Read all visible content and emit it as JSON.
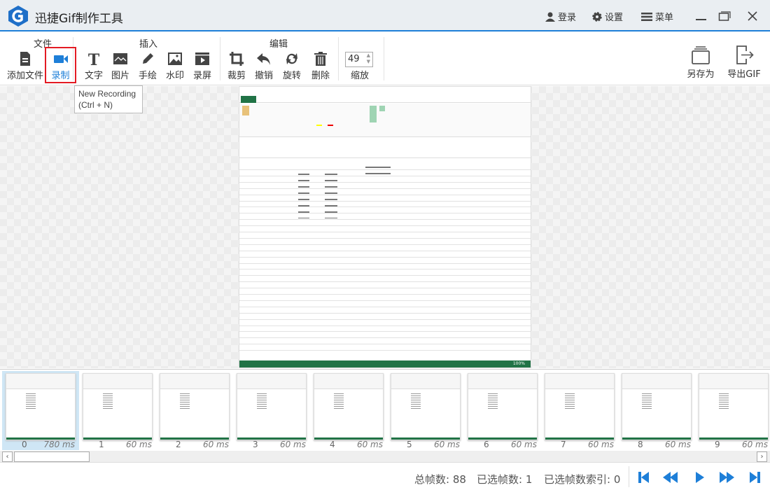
{
  "app": {
    "title": "迅捷Gif制作工具"
  },
  "titlebar": {
    "login": "登录",
    "settings": "设置",
    "menu": "菜单"
  },
  "toolbar": {
    "groups": {
      "file": "文件",
      "insert": "插入",
      "edit": "编辑"
    },
    "add_file": "添加文件",
    "record": "录制",
    "text": "文字",
    "image": "图片",
    "draw": "手绘",
    "watermark": "水印",
    "screen_record": "录屏",
    "crop": "裁剪",
    "undo": "撤销",
    "rotate": "旋转",
    "delete": "删除",
    "zoom_value": "49",
    "zoom_label": "缩放",
    "save_as": "另存为",
    "export_gif": "导出GIF"
  },
  "tooltip": {
    "line1": "New Recording",
    "line2": "(Ctrl + N)"
  },
  "excel_preview": {
    "zoom": "100%"
  },
  "frames": [
    {
      "index": "0",
      "duration": "780 ms",
      "selected": true
    },
    {
      "index": "1",
      "duration": "60 ms"
    },
    {
      "index": "2",
      "duration": "60 ms"
    },
    {
      "index": "3",
      "duration": "60 ms"
    },
    {
      "index": "4",
      "duration": "60 ms"
    },
    {
      "index": "5",
      "duration": "60 ms"
    },
    {
      "index": "6",
      "duration": "60 ms"
    },
    {
      "index": "7",
      "duration": "60 ms"
    },
    {
      "index": "8",
      "duration": "60 ms"
    },
    {
      "index": "9",
      "duration": "60 ms"
    }
  ],
  "status": {
    "total_frames": "总帧数: 88",
    "selected_frames": "已选帧数: 1",
    "selected_index": "已选帧数索引: 0"
  },
  "colors": {
    "accent": "#1e7fd8",
    "highlight": "#e31b23",
    "excel_green": "#217346"
  }
}
